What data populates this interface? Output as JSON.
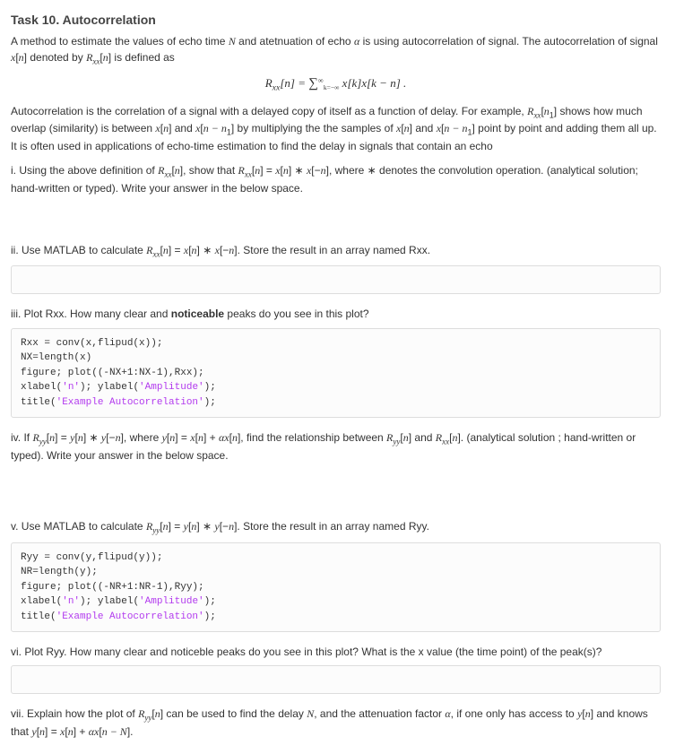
{
  "title": "Task 10. Autocorrelation",
  "intro_html": "A method to estimate the values of echo time <span class='serif ital'>N</span> and atetnuation of echo <span class='serif ital'>α</span> is using autocorrelation of signal. The autocorrelation of signal <span class='serif ital'>x</span>[<span class='serif ital'>n</span>] denoted by <span class='serif ital'>R<sub>xx</sub></span>[<span class='serif ital'>n</span>] is defined as",
  "formula_html": "R<sub>xx</sub>[n] = <span style='font-size:15px'>∑</span><span style='font-size:10px;font-style:normal'><sup>∞</sup><sub>k=−∞</sub></span> x[k]x[k − n] .",
  "para2_html": "Autocorrelation is the correlation of a signal with a delayed copy of itself as a function of delay. For example, <span class='serif ital'>R<sub>xx</sub></span>[<span class='serif ital'>n</span><sub>1</sub>] shows how much overlap (similarity) is between <span class='serif ital'>x</span>[<span class='serif ital'>n</span>] and <span class='serif ital'>x</span>[<span class='serif ital'>n − n</span><sub>1</sub>] by multiplying the the samples of <span class='serif ital'>x</span>[<span class='serif ital'>n</span>] and <span class='serif ital'>x</span>[<span class='serif ital'>n − n</span><sub>1</sub>] point by point and adding them all up. It is often used in applications of echo-time estimation to find the delay in signals that contain an echo",
  "q1_html": "i. Using the above definition of <span class='serif ital'>R<sub>xx</sub></span>[<span class='serif ital'>n</span>], show that <span class='serif ital'>R<sub>xx</sub></span>[<span class='serif ital'>n</span>] = <span class='serif ital'>x</span>[<span class='serif ital'>n</span>] ∗ <span class='serif ital'>x</span>[−<span class='serif ital'>n</span>], where ∗ denotes the convolution operation. (analytical solution; hand-written or typed). Write your answer in the below space.",
  "q2_html": "ii. Use MATLAB to calculate <span class='serif ital'>R<sub>xx</sub></span>[<span class='serif ital'>n</span>] = <span class='serif ital'>x</span>[<span class='serif ital'>n</span>] ∗ <span class='serif ital'>x</span>[−<span class='serif ital'>n</span>]. Store the result in an array named Rxx.",
  "q3_html": "iii. Plot Rxx. How many clear and <b>noticeable</b> peaks do you see in this plot?",
  "code1_html": "Rxx = conv(x,flipud(x));\nNX=length(x)\nfigure; plot((-NX+1:NX-1),Rxx);\nxlabel(<span class='mstr'>'n'</span>); ylabel(<span class='mstr'>'Amplitude'</span>);\ntitle(<span class='mstr'>'Example Autocorrelation'</span>);",
  "q4_html": "iv. If <span class='serif ital'>R<sub>yy</sub></span>[<span class='serif ital'>n</span>] = <span class='serif ital'>y</span>[<span class='serif ital'>n</span>] ∗ <span class='serif ital'>y</span>[−<span class='serif ital'>n</span>], where <span class='serif ital'>y</span>[<span class='serif ital'>n</span>] = <span class='serif ital'>x</span>[<span class='serif ital'>n</span>] + <span class='serif ital'>αx</span>[<span class='serif ital'>n</span>], find the relationship between <span class='serif ital'>R<sub>yy</sub></span>[<span class='serif ital'>n</span>] and <span class='serif ital'>R<sub>xx</sub></span>[<span class='serif ital'>n</span>]. (analytical solution ; hand-written or typed). Write your answer in the below space.",
  "q5_html": "v. Use MATLAB to calculate <span class='serif ital'>R<sub>yy</sub></span>[<span class='serif ital'>n</span>] = <span class='serif ital'>y</span>[<span class='serif ital'>n</span>] ∗ <span class='serif ital'>y</span>[−<span class='serif ital'>n</span>]. Store the result in an array named Ryy.",
  "code2_html": "Ryy = conv(y,flipud(y));\nNR=length(y);\nfigure; plot((-NR+1:NR-1),Ryy);\nxlabel(<span class='mstr'>'n'</span>); ylabel(<span class='mstr'>'Amplitude'</span>);\ntitle(<span class='mstr'>'Example Autocorrelation'</span>);",
  "q6_html": "vi. Plot Ryy. How many clear and noticeble peaks do you see in this plot? What is the x value (the time point) of the peak(s)?",
  "q7_html": "vii. Explain how the plot of <span class='serif ital'>R<sub>yy</sub></span>[<span class='serif ital'>n</span>] can be used to find the delay <span class='serif ital'>N</span>, and the attenuation factor <span class='serif ital'>α</span>, if one only has access to <span class='serif ital'>y</span>[<span class='serif ital'>n</span>] and knows that <span class='serif ital'>y</span>[<span class='serif ital'>n</span>] = <span class='serif ital'>x</span>[<span class='serif ital'>n</span>] + <span class='serif ital'>αx</span>[<span class='serif ital'>n − N</span>]."
}
